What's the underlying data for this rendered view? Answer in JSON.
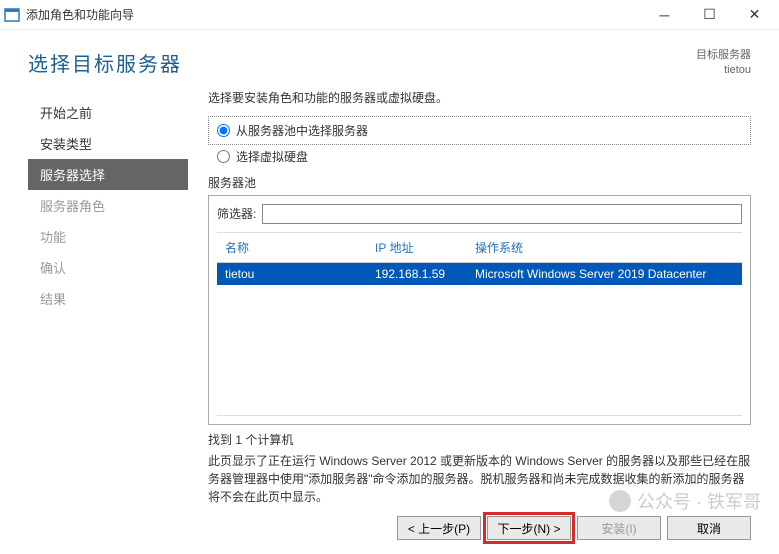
{
  "window": {
    "title": "添加角色和功能向导"
  },
  "header": {
    "page_title": "选择目标服务器",
    "dest_label": "目标服务器",
    "dest_value": "tietou"
  },
  "sidebar": {
    "items": [
      {
        "label": "开始之前",
        "state": "done"
      },
      {
        "label": "安装类型",
        "state": "done"
      },
      {
        "label": "服务器选择",
        "state": "active"
      },
      {
        "label": "服务器角色",
        "state": "pending"
      },
      {
        "label": "功能",
        "state": "pending"
      },
      {
        "label": "确认",
        "state": "pending"
      },
      {
        "label": "结果",
        "state": "pending"
      }
    ]
  },
  "panel": {
    "instruction": "选择要安装角色和功能的服务器或虚拟硬盘。",
    "radio_pool": "从服务器池中选择服务器",
    "radio_vhd": "选择虚拟硬盘",
    "pool_label": "服务器池",
    "filter_label": "筛选器:",
    "filter_value": "",
    "columns": {
      "name": "名称",
      "ip": "IP 地址",
      "os": "操作系统"
    },
    "rows": [
      {
        "name": "tietou",
        "ip": "192.168.1.59",
        "os": "Microsoft Windows Server 2019 Datacenter",
        "selected": true
      }
    ],
    "count_text": "找到 1 个计算机",
    "description": "此页显示了正在运行 Windows Server 2012 或更新版本的 Windows Server 的服务器以及那些已经在服务器管理器中使用\"添加服务器\"命令添加的服务器。脱机服务器和尚未完成数据收集的新添加的服务器将不会在此页中显示。"
  },
  "footer": {
    "prev": "< 上一步(P)",
    "next": "下一步(N) >",
    "install": "安装(I)",
    "cancel": "取消"
  },
  "watermark": "公众号 · 铁军哥"
}
